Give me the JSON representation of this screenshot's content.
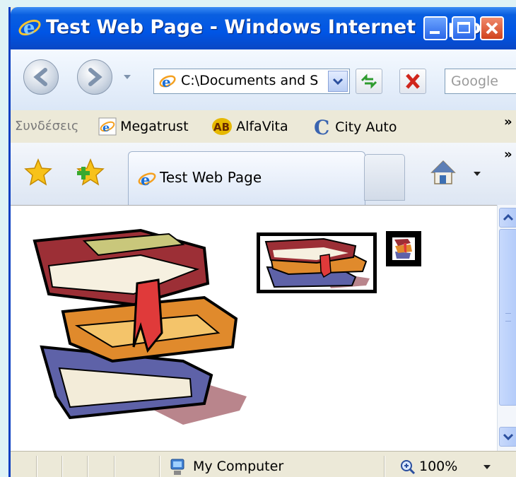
{
  "window": {
    "title": "Test Web Page - Windows Internet Explo..."
  },
  "navbar": {
    "address": "C:\\Documents and S",
    "search_placeholder": "Google"
  },
  "links": {
    "label": "Συνδέσεις",
    "items": [
      {
        "label": "Megatrust",
        "icon": "ie-icon"
      },
      {
        "label": "AlfaVita",
        "icon": "ab-icon"
      },
      {
        "label": "City Auto",
        "icon": "c-icon"
      }
    ],
    "more": "»"
  },
  "tabs": {
    "active_label": "Test Web Page",
    "more": "»"
  },
  "status": {
    "zone": "My Computer",
    "zoom": "100%"
  },
  "colors": {
    "titlebar": "#0055e5",
    "window_frame": "#ece9d8"
  }
}
